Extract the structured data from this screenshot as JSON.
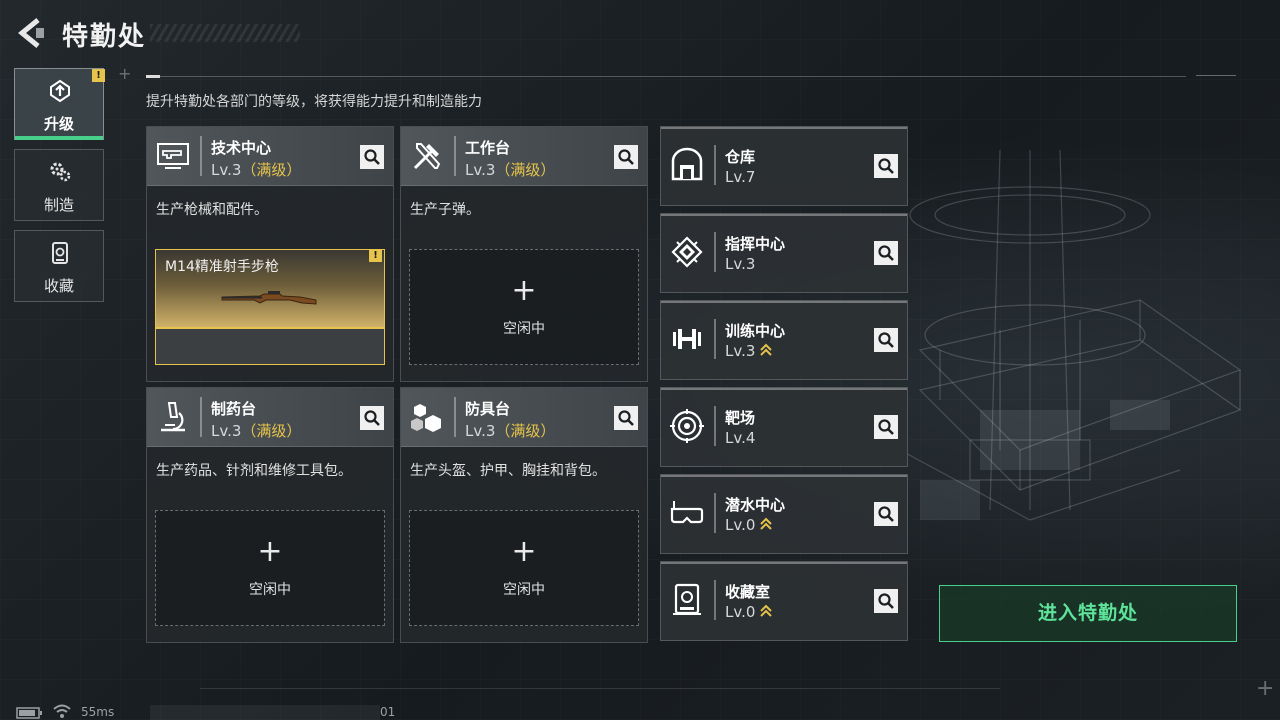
{
  "header": {
    "title": "特勤处",
    "subtitle": "提升特勤处各部门的等级，将获得能力提升和制造能力"
  },
  "tabs": [
    {
      "label": "升级",
      "icon": "upgrade-icon",
      "active": true,
      "alert": "!"
    },
    {
      "label": "制造",
      "icon": "gear-cluster-icon",
      "active": false
    },
    {
      "label": "收藏",
      "icon": "collection-icon",
      "active": false
    }
  ],
  "cards": [
    {
      "name": "技术中心",
      "level": "Lv.3",
      "maxed": "（满级）",
      "desc": "生产枪械和配件。",
      "icon": "monitor-gun-icon",
      "production": {
        "item": "M14精准射手步枪",
        "alert": "!"
      }
    },
    {
      "name": "工作台",
      "level": "Lv.3",
      "maxed": "（满级）",
      "desc": "生产子弹。",
      "icon": "tools-icon",
      "slot": {
        "plus": "+",
        "status": "空闲中"
      }
    },
    {
      "name": "制药台",
      "level": "Lv.3",
      "maxed": "（满级）",
      "desc": "生产药品、针剂和维修工具包。",
      "icon": "microscope-icon",
      "slot": {
        "plus": "+",
        "status": "空闲中"
      }
    },
    {
      "name": "防具台",
      "level": "Lv.3",
      "maxed": "（满级）",
      "desc": "生产头盔、护甲、胸挂和背包。",
      "icon": "armor-cubes-icon",
      "slot": {
        "plus": "+",
        "status": "空闲中"
      }
    }
  ],
  "rooms": [
    {
      "name": "仓库",
      "level": "Lv.7",
      "upgradable": false,
      "icon": "warehouse-icon"
    },
    {
      "name": "指挥中心",
      "level": "Lv.3",
      "upgradable": false,
      "icon": "chip-icon"
    },
    {
      "name": "训练中心",
      "level": "Lv.3",
      "upgradable": true,
      "icon": "dumbbell-icon"
    },
    {
      "name": "靶场",
      "level": "Lv.4",
      "upgradable": false,
      "icon": "target-icon"
    },
    {
      "name": "潜水中心",
      "level": "Lv.0",
      "upgradable": true,
      "icon": "diving-mask-icon"
    },
    {
      "name": "收藏室",
      "level": "Lv.0",
      "upgradable": true,
      "icon": "collection-room-icon"
    }
  ],
  "enter_button": "进入特勤处",
  "status": {
    "ping": "55ms",
    "uid_tail": "01"
  },
  "colors": {
    "accent_green": "#48d08a",
    "maxed_gold": "#e6c34a"
  }
}
